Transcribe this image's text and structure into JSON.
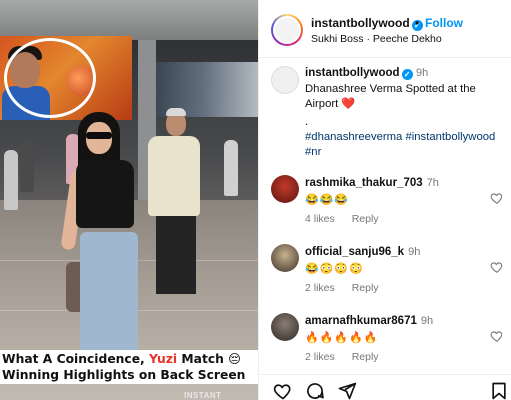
{
  "media": {
    "caption_line1_pre": "What A Coincidence, ",
    "caption_line1_highlight": "Yuzi",
    "caption_line1_post": " Match 😔",
    "caption_line2": "Winning Highlights on Back Screen",
    "watermark": "INSTANT"
  },
  "header": {
    "username": "instantbollywood",
    "verified_mark": "✓",
    "separator": "•",
    "follow_label": "Follow",
    "audio": "Sukhi Boss · Peeche Dekho"
  },
  "post": {
    "username": "instantbollywood",
    "verified_mark": "✓",
    "time": "9h",
    "text": "Dhanashree Verma Spotted at the Airport",
    "text_emoji": "❤️",
    "tags_dot": ".",
    "tags": "#dhanashreeverma #instantbollywood",
    "tags_line2": "#nr"
  },
  "comments": [
    {
      "user": "rashmika_thakur_703",
      "time": "7h",
      "text": "😂😂😂",
      "likes": "4 likes",
      "reply": "Reply"
    },
    {
      "user": "official_sanju96_k",
      "time": "9h",
      "text": "😂😳😳😳",
      "likes": "2 likes",
      "reply": "Reply"
    },
    {
      "user": "amarnafhkumar8671",
      "time": "9h",
      "text": "🔥🔥🔥🔥🔥",
      "likes": "2 likes",
      "reply": "Reply"
    }
  ],
  "icons": {
    "like": "heart-icon",
    "comment": "comment-icon",
    "share": "send-icon",
    "save": "bookmark-icon"
  },
  "colors": {
    "follow": "#0095f6",
    "hashtag": "#00376b",
    "caption_highlight": "#e8322a",
    "verified": "#0095f6"
  }
}
